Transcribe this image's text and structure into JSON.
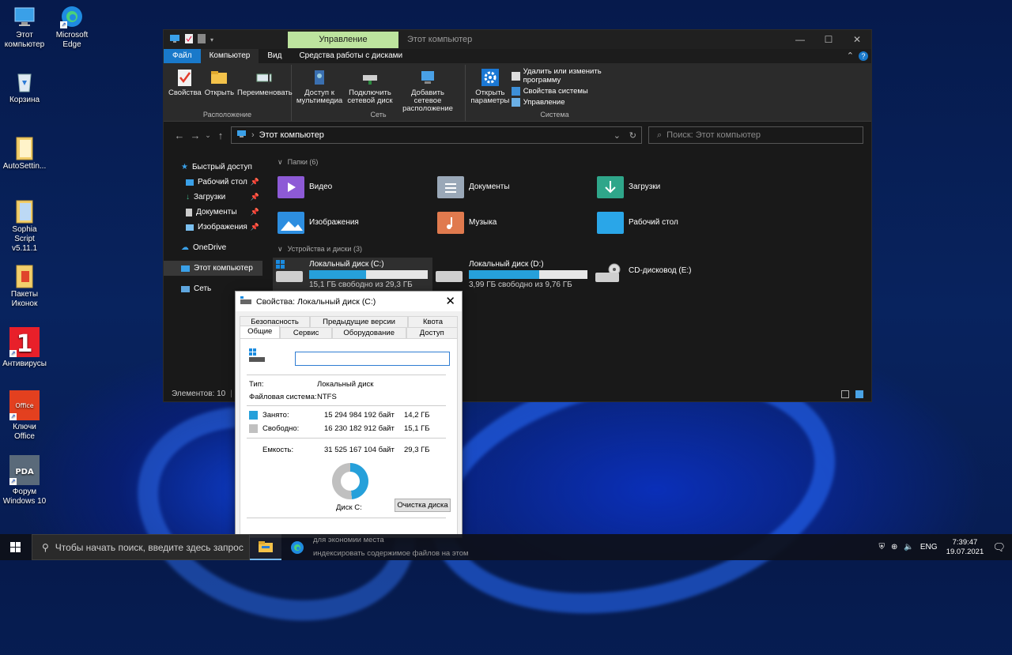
{
  "desktop": {
    "icons": [
      {
        "label": "Этот компьютер",
        "icon": "monitor-icon"
      },
      {
        "label": "Microsoft Edge",
        "icon": "edge-icon"
      },
      {
        "label": "Корзина",
        "icon": "recycle-bin-icon"
      },
      {
        "label": "AutoSettin...",
        "icon": "folder-icon"
      },
      {
        "label": "Sophia Script v5.11.1",
        "icon": "folder-icon"
      },
      {
        "label": "Пакеты Иконок",
        "icon": "folder-icon"
      },
      {
        "label": "Антивирусы",
        "icon": "antivirus-icon"
      },
      {
        "label": "Ключи Office",
        "icon": "office-icon"
      },
      {
        "label": "Форум Windows 10",
        "icon": "pda-icon"
      }
    ]
  },
  "explorer": {
    "context_tab": "Управление",
    "window_title": "Этот компьютер",
    "tabs": [
      "Файл",
      "Компьютер",
      "Вид",
      "Средства работы с дисками"
    ],
    "ribbon": {
      "location": {
        "label": "Расположение",
        "buttons": [
          "Свойства",
          "Открыть",
          "Переименовать"
        ]
      },
      "network": {
        "label": "Сеть",
        "buttons": [
          "Доступ к мультимедиа",
          "Подключить сетевой диск",
          "Добавить сетевое расположение"
        ]
      },
      "system": {
        "label": "Система",
        "open_settings": "Открыть параметры",
        "items": [
          "Удалить или изменить программу",
          "Свойства системы",
          "Управление"
        ]
      }
    },
    "address": "Этот компьютер",
    "search_placeholder": "Поиск: Этот компьютер",
    "nav": {
      "quick_access": "Быстрый доступ",
      "items": [
        "Рабочий стол",
        "Загрузки",
        "Документы",
        "Изображения"
      ],
      "onedrive": "OneDrive",
      "this_pc": "Этот компьютер",
      "network": "Сеть"
    },
    "folders_header": "Папки (6)",
    "folders": [
      "Видео",
      "Документы",
      "Загрузки",
      "Изображения",
      "Музыка",
      "Рабочий стол"
    ],
    "drives_header": "Устройства и диски (3)",
    "drives": [
      {
        "name": "Локальный диск (C:)",
        "free": "15,1 ГБ свободно из 29,3 ГБ",
        "used_fraction": 0.48
      },
      {
        "name": "Локальный диск (D:)",
        "free": "3,99 ГБ свободно из 9,76 ГБ",
        "used_fraction": 0.59
      },
      {
        "name": "CD-дисковод (E:)"
      }
    ],
    "status": "Элементов: 10"
  },
  "dialog": {
    "title": "Свойства: Локальный диск (C:)",
    "tabs_row1": [
      "Безопасность",
      "Предыдущие версии",
      "Квота"
    ],
    "tabs_row2": [
      "Общие",
      "Сервис",
      "Оборудование",
      "Доступ"
    ],
    "type_label": "Тип:",
    "type_value": "Локальный диск",
    "fs_label": "Файловая система:",
    "fs_value": "NTFS",
    "used_label": "Занято:",
    "used_bytes": "15 294 984 192 байт",
    "used_gb": "14,2 ГБ",
    "free_label": "Свободно:",
    "free_bytes": "16 230 182 912 байт",
    "free_gb": "15,1 ГБ",
    "capacity_label": "Емкость:",
    "capacity_bytes": "31 525 167 104 байт",
    "capacity_gb": "29,3 ГБ",
    "disk_label": "Диск C:",
    "cleanup_button": "Очистка диска",
    "used_fraction": 0.485,
    "overflow1": "для экономии места",
    "overflow2": "индексировать содержимое файлов на этом",
    "colors": {
      "used": "#26a0da",
      "free": "#c0c0c0"
    }
  },
  "taskbar": {
    "search_placeholder": "Чтобы начать поиск, введите здесь запрос",
    "lang": "ENG",
    "time": "7:39:47",
    "date": "19.07.2021"
  }
}
